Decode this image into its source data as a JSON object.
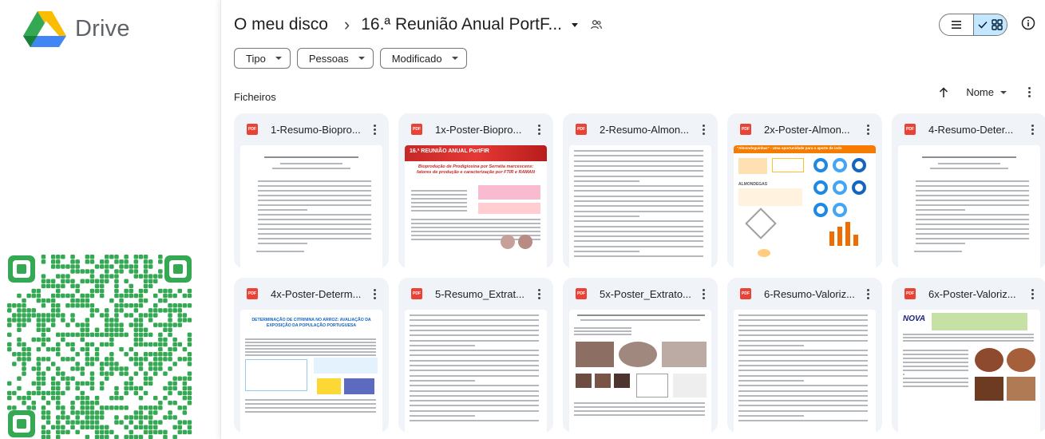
{
  "app": {
    "name": "Drive"
  },
  "breadcrumb": {
    "root": "O meu disco",
    "separator": "›",
    "current": "16.ª Reunião Anual PortF..."
  },
  "filters": [
    {
      "label": "Tipo"
    },
    {
      "label": "Pessoas"
    },
    {
      "label": "Modificado"
    }
  ],
  "section": {
    "title": "Ficheiros"
  },
  "sort": {
    "label": "Nome"
  },
  "files": [
    {
      "name": "1-Resumo-Biopro...",
      "type": "PDF",
      "thumb": "abstract"
    },
    {
      "name": "1x-Poster-Biopro...",
      "type": "PDF",
      "thumb": "poster-red",
      "thumb_text": {
        "title": "16.ª REUNIÃO ANUAL PortFIR",
        "subtitle": "Bioprodução de Prodigiosina por Serratia marcescens: fatores de produção e caracterização por FTIR e RAMAN"
      }
    },
    {
      "name": "2-Resumo-Almon...",
      "type": "PDF",
      "thumb": "text"
    },
    {
      "name": "2x-Poster-Almon...",
      "type": "PDF",
      "thumb": "poster-orange",
      "thumb_text": {
        "title": "\"Almondeguinhas\" - Uma oportunidade para o aporte de iodo",
        "label": "ALMONDEGAS"
      }
    },
    {
      "name": "4-Resumo-Deter...",
      "type": "PDF",
      "thumb": "abstract"
    },
    {
      "name": "4x-Poster-Determ...",
      "type": "PDF",
      "thumb": "poster-blue",
      "thumb_text": {
        "title": "DETERMINAÇÃO DE CITRININA NO ARROZ: AVALIAÇÃO DA EXPOSIÇÃO DA POPULAÇÃO PORTUGUESA"
      }
    },
    {
      "name": "5-Resumo_Extrat...",
      "type": "PDF",
      "thumb": "text"
    },
    {
      "name": "5x-Poster_Extrato...",
      "type": "PDF",
      "thumb": "poster-photos"
    },
    {
      "name": "6-Resumo-Valoriz...",
      "type": "PDF",
      "thumb": "text"
    },
    {
      "name": "6x-Poster-Valoriz...",
      "type": "PDF",
      "thumb": "poster-nova",
      "thumb_text": {
        "logo": "NOVA"
      }
    }
  ],
  "colors": {
    "pdf": "#ea4335",
    "accent": "#c2e7ff",
    "card_bg": "#f0f4f9",
    "qr": "#34a853"
  },
  "icons": {
    "logo": "google-drive-logo",
    "shared": "people-icon",
    "list": "list-view-icon",
    "grid": "grid-view-icon",
    "info": "info-icon",
    "sort": "arrow-up-icon",
    "more": "more-vert-icon"
  }
}
